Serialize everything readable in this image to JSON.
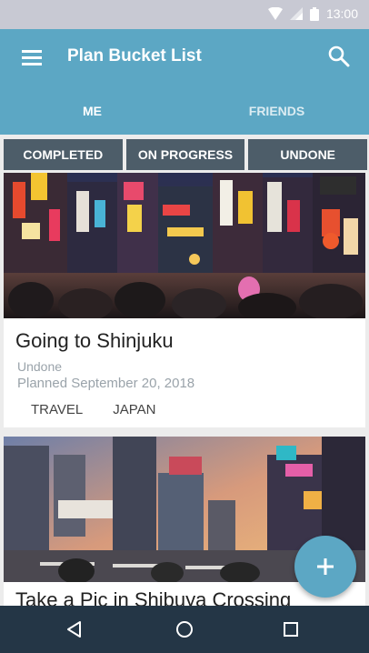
{
  "status_bar": {
    "time": "13:00",
    "icons": [
      "wifi-icon",
      "signal-icon",
      "battery-icon"
    ]
  },
  "app_bar": {
    "title": "Plan Bucket List",
    "menu_icon": "menu-icon",
    "search_icon": "search-icon"
  },
  "tabs": [
    {
      "label": "ME",
      "active": true
    },
    {
      "label": "FRIENDS",
      "active": false
    }
  ],
  "filters": [
    {
      "label": "COMPLETED"
    },
    {
      "label": "ON PROGRESS"
    },
    {
      "label": "UNDONE"
    }
  ],
  "cards": [
    {
      "title": "Going to Shinjuku",
      "status": "Undone",
      "date": "Planned September 20, 2018",
      "tags": [
        "TRAVEL",
        "JAPAN"
      ]
    },
    {
      "title": "Take a Pic in Shibuya Crossing"
    }
  ],
  "fab": {
    "icon": "plus-icon"
  },
  "nav_bar": {
    "icons": [
      "back-icon",
      "home-icon",
      "recents-icon"
    ]
  },
  "colors": {
    "primary": "#5ca7c4",
    "filter_button": "#4d5d69",
    "nav_bar": "#243646",
    "status_bar": "#c8c9d3",
    "secondary_text": "#9aa3aa"
  }
}
